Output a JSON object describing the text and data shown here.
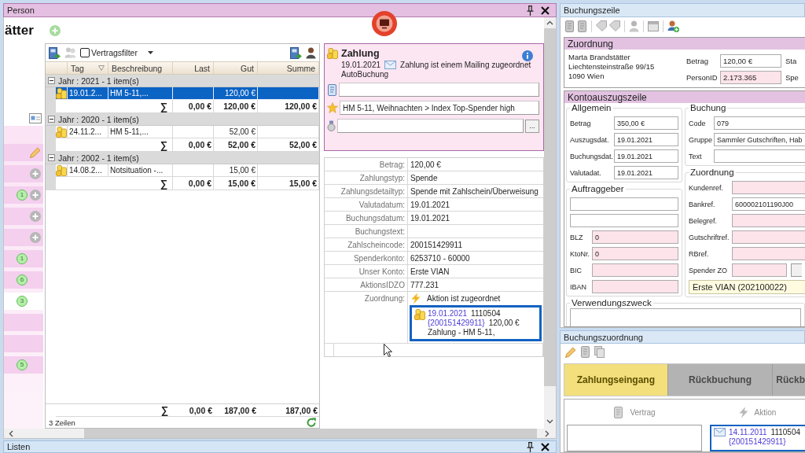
{
  "person_panel": {
    "title": "Person",
    "heading": "ätter",
    "sidebar": [
      {
        "kind": "edit",
        "selected": false
      },
      {
        "kind": "add",
        "selected": false
      },
      {
        "kind": "add",
        "badge": "1",
        "selected": false
      },
      {
        "kind": "add",
        "selected": false
      },
      {
        "kind": "add",
        "selected": false
      },
      {
        "kind": "none",
        "badge": "1",
        "selected": false
      },
      {
        "kind": "none",
        "badge": "6",
        "selected": false
      },
      {
        "kind": "none",
        "badge": "3",
        "selected": true
      },
      {
        "kind": "none",
        "selected": false
      },
      {
        "kind": "none",
        "selected": false
      },
      {
        "kind": "none",
        "badge": "5",
        "selected": false
      }
    ],
    "grid": {
      "filter": {
        "label": "Vertragsfilter",
        "checked": false
      },
      "columns": [
        "Tag",
        "Beschreibung",
        "Last",
        "Gut",
        "Summe"
      ],
      "groups": [
        {
          "label": "Jahr : 2021 - 1 item(s)",
          "expanded": true,
          "rows": [
            {
              "day": "19.01.2...",
              "description": "HM 5-11,...",
              "credit": "120,00 €",
              "selected": true
            }
          ],
          "totals": {
            "symbol": "∑",
            "debit": "0,00 €",
            "credit": "120,00 €",
            "balance": "120,00 €"
          }
        },
        {
          "label": "Jahr : 2020 - 1 item(s)",
          "expanded": true,
          "rows": [
            {
              "day": "24.11.2...",
              "description": "HM 5-11,...",
              "credit": "52,00 €",
              "selected": false
            }
          ],
          "totals": {
            "symbol": "∑",
            "debit": "0,00 €",
            "credit": "52,00 €",
            "balance": "52,00 €"
          }
        },
        {
          "label": "Jahr : 2002 - 1 item(s)",
          "expanded": true,
          "rows": [
            {
              "day": "14.08.2...",
              "description": "Notsituation -...",
              "credit": "15,00 €",
              "selected": false
            }
          ],
          "totals": {
            "symbol": "∑",
            "debit": "0,00 €",
            "credit": "15,00 €",
            "balance": "15,00 €"
          }
        }
      ],
      "grand_total": {
        "symbol": "∑",
        "debit": "0,00 €",
        "credit": "187,00 €",
        "balance": "187,00 €"
      },
      "row_count": "3 Zeilen"
    },
    "payment": {
      "title": "Zahlung",
      "date": "19.01.2021",
      "mailing_note": "Zahlung ist einem Mailing zugeordnet",
      "source": "AutoBuchung",
      "fields": [
        {
          "kind": "contract"
        },
        {
          "kind": "campaign",
          "value": "HM 5-11, Weihnachten > Index Top-Spender high"
        },
        {
          "kind": "medal",
          "button": "..."
        }
      ]
    },
    "details": [
      {
        "label": "Betrag:",
        "value": "120,00 €"
      },
      {
        "label": "Zahlungstyp:",
        "value": "Spende"
      },
      {
        "label": "Zahlungsdetailtyp:",
        "value": "Spende mit Zahlschein/Überweisung"
      },
      {
        "label": "Valutadatum:",
        "value": "19.01.2021"
      },
      {
        "label": "Buchungsdatum:",
        "value": "19.01.2021"
      },
      {
        "label": "Buchungstext:"
      },
      {
        "label": "Zahlscheincode:",
        "value": "200151429911"
      },
      {
        "label": "Spenderkonto:",
        "value": "6253710 - 60000"
      },
      {
        "label": "Unser Konto:",
        "value": "Erste VIAN"
      },
      {
        "label": "AktionsIDZO",
        "value": "777.231"
      }
    ],
    "assignment": {
      "label": "Zuordnung:",
      "status": "Aktion ist zugeordnet",
      "entry": {
        "date": "19.01.2021",
        "number": "1110504",
        "code": "{200151429911}",
        "amount": "120,00 €",
        "text": "Zahlung - HM 5-11,"
      }
    }
  },
  "booking_line": {
    "title": "Buchungszeile",
    "assignment": {
      "title": "Zuordnung",
      "address": [
        "Marta Brandstätter",
        "Liechtensteinstraße 99/15",
        "1090 Wien"
      ],
      "fields": [
        {
          "label": "Betrag",
          "value": "120,00 €",
          "highlighted": false,
          "side_label": "Sta"
        },
        {
          "label": "PersonID",
          "value": "2.173.365",
          "highlighted": true,
          "side_label": "Spe"
        }
      ]
    },
    "statement_line": {
      "title": "Kontoauszugszeile",
      "general": {
        "title": "Allgemein",
        "fields": [
          {
            "label": "Betrag",
            "value": "350,00 €",
            "highlighted": false
          },
          {
            "label": "Auszugsdat.",
            "value": "19.01.2021",
            "highlighted": false
          },
          {
            "label": "Buchungsdat.",
            "value": "19.01.2021",
            "highlighted": false
          },
          {
            "label": "Valutadat.",
            "value": "19.01.2021",
            "highlighted": false
          }
        ]
      },
      "client": {
        "title": "Auftraggeber",
        "fields": [
          {
            "highlighted": false
          },
          {
            "highlighted": false
          },
          {
            "label": "BLZ",
            "value": "0",
            "highlighted": true
          },
          {
            "label": "KtoNr.",
            "value": "0",
            "highlighted": true
          },
          {
            "label": "BIC",
            "highlighted": true
          },
          {
            "label": "IBAN",
            "highlighted": true
          }
        ]
      },
      "booking": {
        "title": "Buchung",
        "fields": [
          {
            "label": "Code",
            "value": "079",
            "highlighted": false
          },
          {
            "label": "Gruppe",
            "value": "Sammler Gutschriften, Hab",
            "highlighted": false
          },
          {
            "label": "Text",
            "highlighted": false
          }
        ]
      },
      "assignment": {
        "title": "Zuordnung",
        "fields": [
          {
            "kind": "text",
            "label": "Kundenref.",
            "highlighted": true
          },
          {
            "kind": "text",
            "label": "Bankref.",
            "value": "600002101190J00",
            "highlighted": false
          },
          {
            "kind": "text",
            "label": "Belegref.",
            "highlighted": true
          },
          {
            "kind": "text",
            "label": "Gutschriftref.",
            "highlighted": true
          },
          {
            "kind": "text",
            "label": "RBref.",
            "highlighted": true
          },
          {
            "kind": "lookup",
            "label": "Spender ZO",
            "highlighted": true
          }
        ],
        "donor_account": "Erste VIAN (202100022)"
      },
      "purpose": {
        "title": "Verwendungszweck"
      }
    }
  },
  "allocation": {
    "title": "Buchungszuordnung",
    "tabs": [
      {
        "label": "Zahlungseingang",
        "selected": true
      },
      {
        "label": "Rückbuchung",
        "selected": false
      },
      {
        "label": "Rückb",
        "selected": false
      }
    ],
    "contract": {
      "title": "Vertrag"
    },
    "campaign": {
      "title": "Aktion",
      "entry": {
        "date": "14.11.2011",
        "number": "1110504",
        "code": "{200151429911}"
      }
    }
  },
  "lists_panel": {
    "title": "Listen"
  }
}
